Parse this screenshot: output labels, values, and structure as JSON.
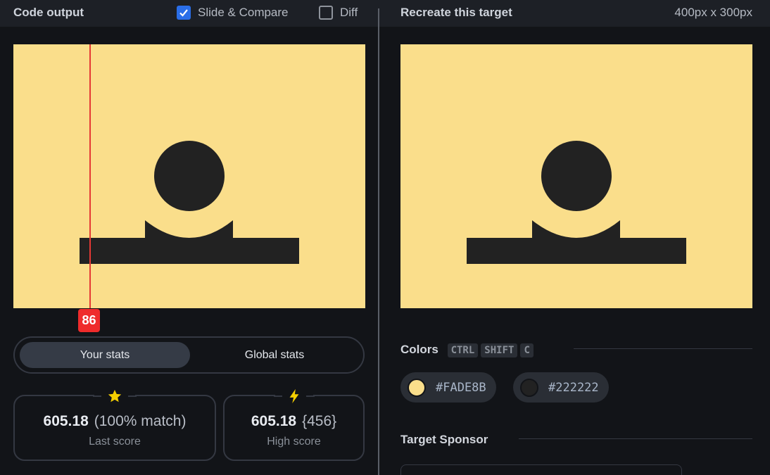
{
  "header": {
    "left_title": "Code output",
    "slide_compare_label": "Slide & Compare",
    "slide_compare_checked": true,
    "diff_label": "Diff",
    "diff_checked": false,
    "right_title": "Recreate this target",
    "dimensions": "400px x 300px"
  },
  "slider": {
    "value": "86"
  },
  "stats": {
    "tabs": [
      "Your stats",
      "Global stats"
    ],
    "active_tab": "Your stats",
    "last_score": {
      "value": "605.18",
      "extra": "(100% match)",
      "label": "Last score",
      "icon": "star-icon"
    },
    "high_score": {
      "value": "605.18",
      "extra": "{456}",
      "label": "High score",
      "icon": "bolt-icon"
    }
  },
  "colors_section": {
    "title": "Colors",
    "shortcut": [
      "CTRL",
      "SHIFT",
      "C"
    ],
    "swatches": [
      {
        "hex": "#FADE8B",
        "label": "#FADE8B"
      },
      {
        "hex": "#222222",
        "label": "#222222"
      }
    ]
  },
  "sponsor_section": {
    "title": "Target Sponsor"
  },
  "theme": {
    "background": "#121418",
    "canvas_bg": "#FADE8B",
    "shape_color": "#222222",
    "accent": "#2a6ee8",
    "slider_color": "#ef2b2b",
    "icon_yellow": "#f5cf00"
  }
}
